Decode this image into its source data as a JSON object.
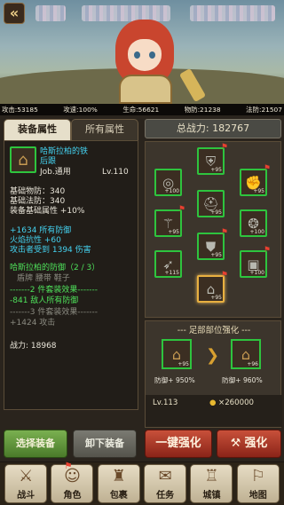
{
  "top_stats": [
    {
      "label": "攻击:53185"
    },
    {
      "label": "攻速:100%"
    },
    {
      "label": "生命:56621"
    },
    {
      "label": "物防:21238"
    },
    {
      "label": "法防:21507"
    }
  ],
  "tabs": [
    "装备属性",
    "所有属性"
  ],
  "item": {
    "name_line1": "哈斯拉柏的铁",
    "name_line2": "后跟",
    "job": "Job.通用",
    "level": "Lv.110",
    "base_lines": [
      "基础物防：340",
      "基础法防：340",
      "装备基础属性 +10%"
    ],
    "bonus_lines": [
      "+1634 所有防御",
      "火焰抗性 +60",
      "攻击者受到 1394 伤害"
    ],
    "set_title": "哈斯拉柏的防御（2 / 3）",
    "set_parts": "盾牌 腰带 鞋子",
    "set2_header": "-------2 件套装效果-------",
    "set2_effect": "-841 敌人所有防御",
    "set3_header": "-------3 件套装效果-------",
    "set3_effect": "+1424 攻击",
    "battle_power": "战力: 18968"
  },
  "total_power": "总战力: 182767",
  "slots": [
    {
      "icon": "ring-icon",
      "glyph": "◎",
      "level": "+100"
    },
    {
      "icon": "shoulder-armor-icon",
      "glyph": "⛨",
      "level": "+95"
    },
    {
      "icon": "gauntlet-icon",
      "glyph": "✊",
      "level": "+95"
    },
    {
      "icon": "staff-icon",
      "glyph": "⚚",
      "level": "+95"
    },
    {
      "icon": "helmet-icon",
      "glyph": "⛑",
      "level": "+95"
    },
    {
      "icon": "amulet-icon",
      "glyph": "❂",
      "level": "+100"
    },
    {
      "icon": "bow-icon",
      "glyph": "➶",
      "level": "+115"
    },
    {
      "icon": "chest-armor-icon",
      "glyph": "⛊",
      "level": "+95"
    },
    {
      "icon": "belt-icon",
      "glyph": "▣",
      "level": "+100"
    },
    {
      "icon": "boots-icon",
      "glyph": "⌂",
      "level": "+95"
    }
  ],
  "strength": {
    "title": "--- 足部部位强化 ---",
    "from_level": "+95",
    "to_level": "+96",
    "from_bonus": "防御+ 950%",
    "to_bonus": "防御+ 960%",
    "req_level": "Lv.113",
    "cost": "×260000"
  },
  "buttons": {
    "select": "选择装备",
    "unequip": "卸下装备",
    "one_key": "一键强化",
    "enhance": "强化"
  },
  "nav": [
    "战斗",
    "角色",
    "包裹",
    "任务",
    "城镇",
    "地图"
  ]
}
